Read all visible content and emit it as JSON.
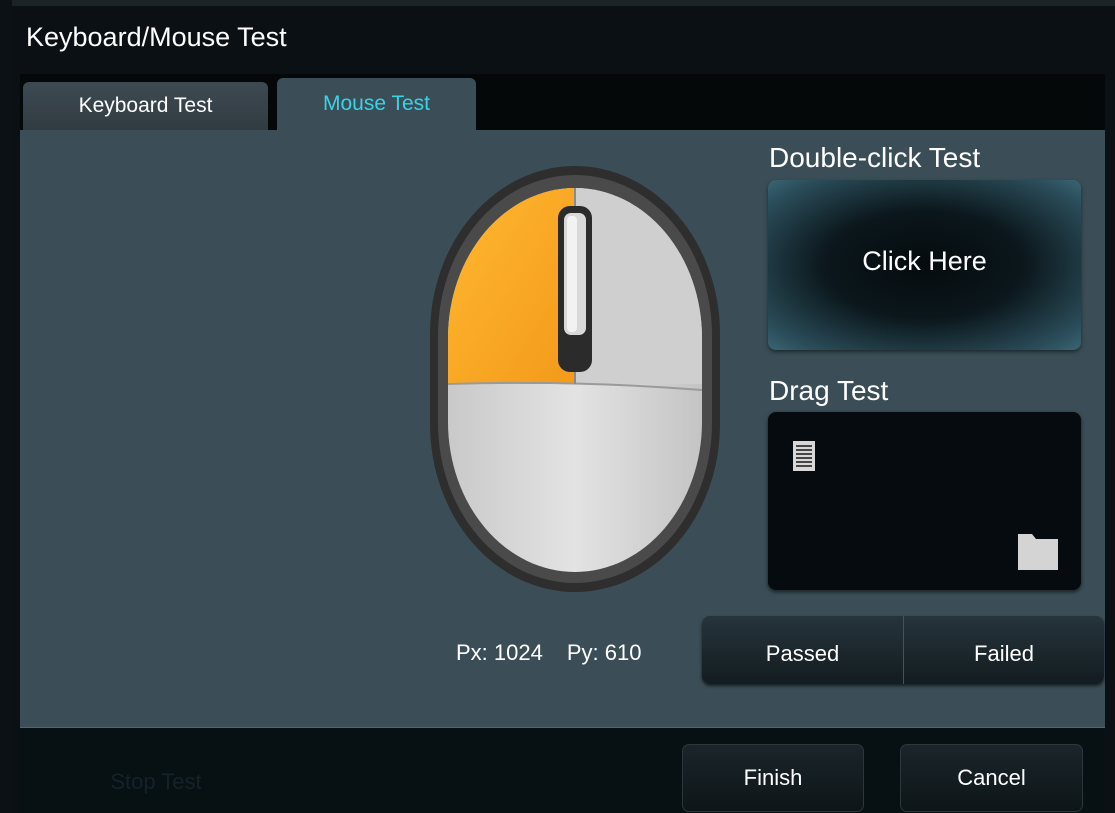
{
  "window": {
    "title": "Keyboard/Mouse Test"
  },
  "tabs": [
    {
      "label": "Keyboard Test",
      "active": false
    },
    {
      "label": "Mouse Test",
      "active": true
    }
  ],
  "mouse": {
    "left_button_pressed": true,
    "highlight_color": "#f6a623"
  },
  "double_click": {
    "heading": "Double-click Test",
    "button_label": "Click Here"
  },
  "drag": {
    "heading": "Drag Test",
    "source_icon": "document-icon",
    "target_icon": "folder-icon"
  },
  "pointer": {
    "px_label": "Px: 1024",
    "py_label": "Py: 610"
  },
  "result": {
    "passed_label": "Passed",
    "failed_label": "Failed"
  },
  "footer": {
    "stop_label": "Stop Test",
    "finish_label": "Finish",
    "cancel_label": "Cancel"
  },
  "colors": {
    "accent_tab_text": "#3ad2e6",
    "panel_bg": "#3b4e57"
  }
}
